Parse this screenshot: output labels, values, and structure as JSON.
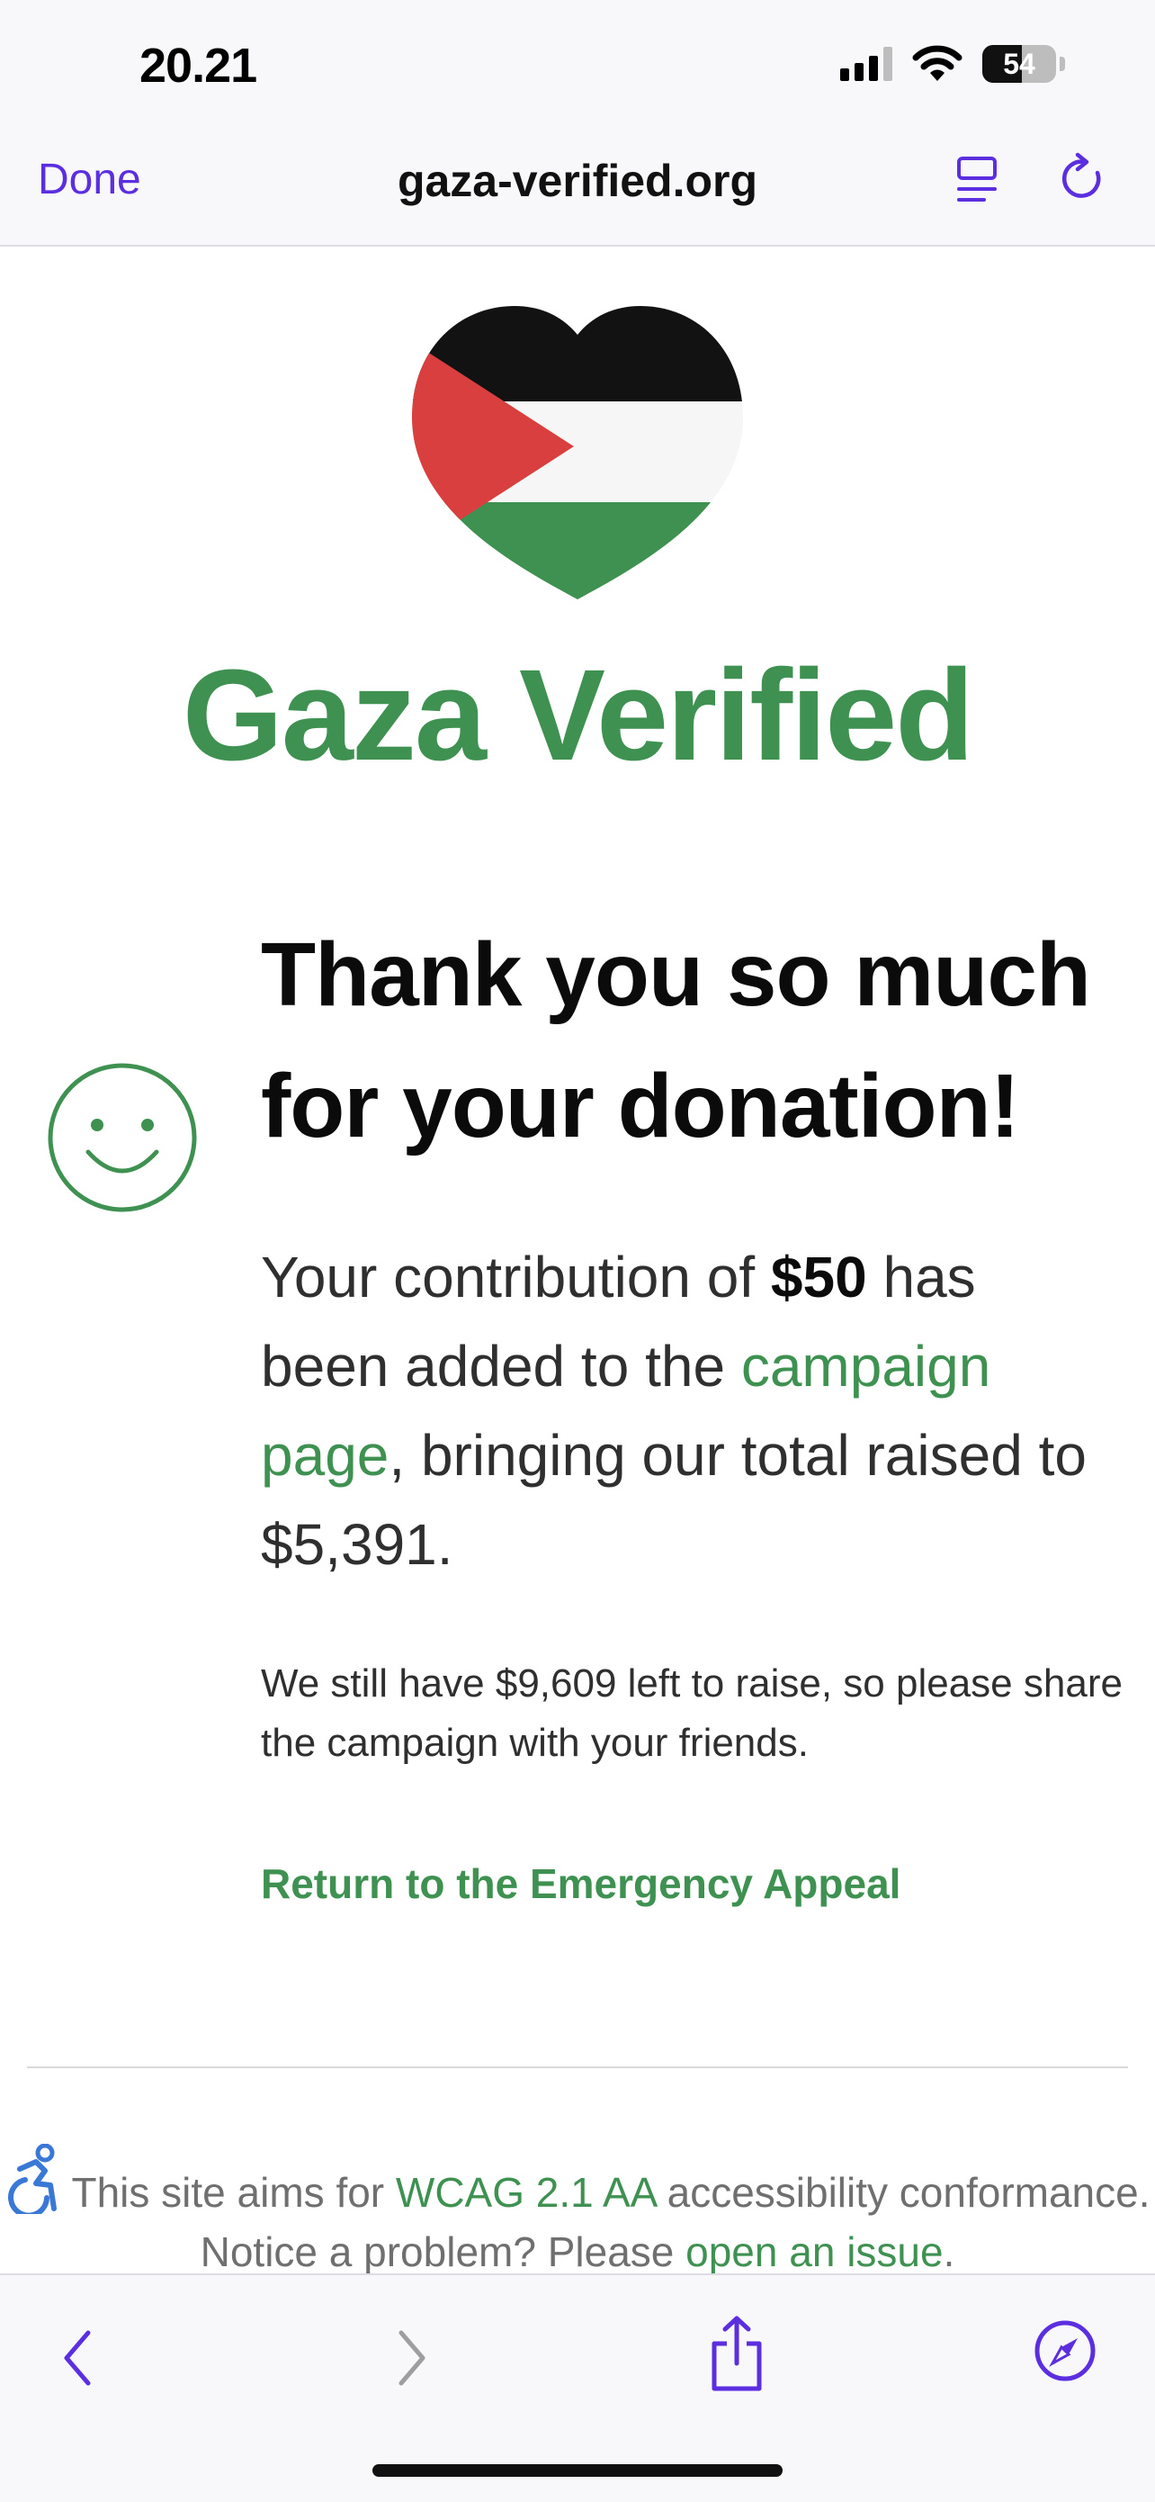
{
  "status_bar": {
    "time": "20.21",
    "battery": "54"
  },
  "nav": {
    "done_label": "Done",
    "url": "gaza-verified.org"
  },
  "brand": {
    "name": "Gaza Verified"
  },
  "main": {
    "heading": "Thank you so much for your donation!",
    "p1_before": "Your contribution of ",
    "p1_amount": "$50",
    "p1_mid": " has been added to the ",
    "p1_link": "campaign page",
    "p1_after": ", bringing our total raised to $5,391.",
    "p2": "We still have $9,609 left to raise, so please share the campaign with your friends.",
    "return_link": "Return to the Emergency Appeal"
  },
  "footer": {
    "before": "This site aims for ",
    "wcag_link": "WCAG 2.1 AA",
    "mid": " accessibility conformance. Notice a problem? Please ",
    "issue_link": "open an issue",
    "after": "."
  },
  "colors": {
    "accent": "#5b2ee0",
    "brand_green": "#3f9152",
    "flag_red": "#d93f3f",
    "flag_black": "#121212"
  },
  "icons": [
    "signal-icon",
    "wifi-icon",
    "battery-icon",
    "reader-icon",
    "reload-icon",
    "heart-flag-logo",
    "smiley-icon",
    "accessibility-icon",
    "back-icon",
    "forward-icon",
    "share-icon",
    "compass-icon"
  ]
}
